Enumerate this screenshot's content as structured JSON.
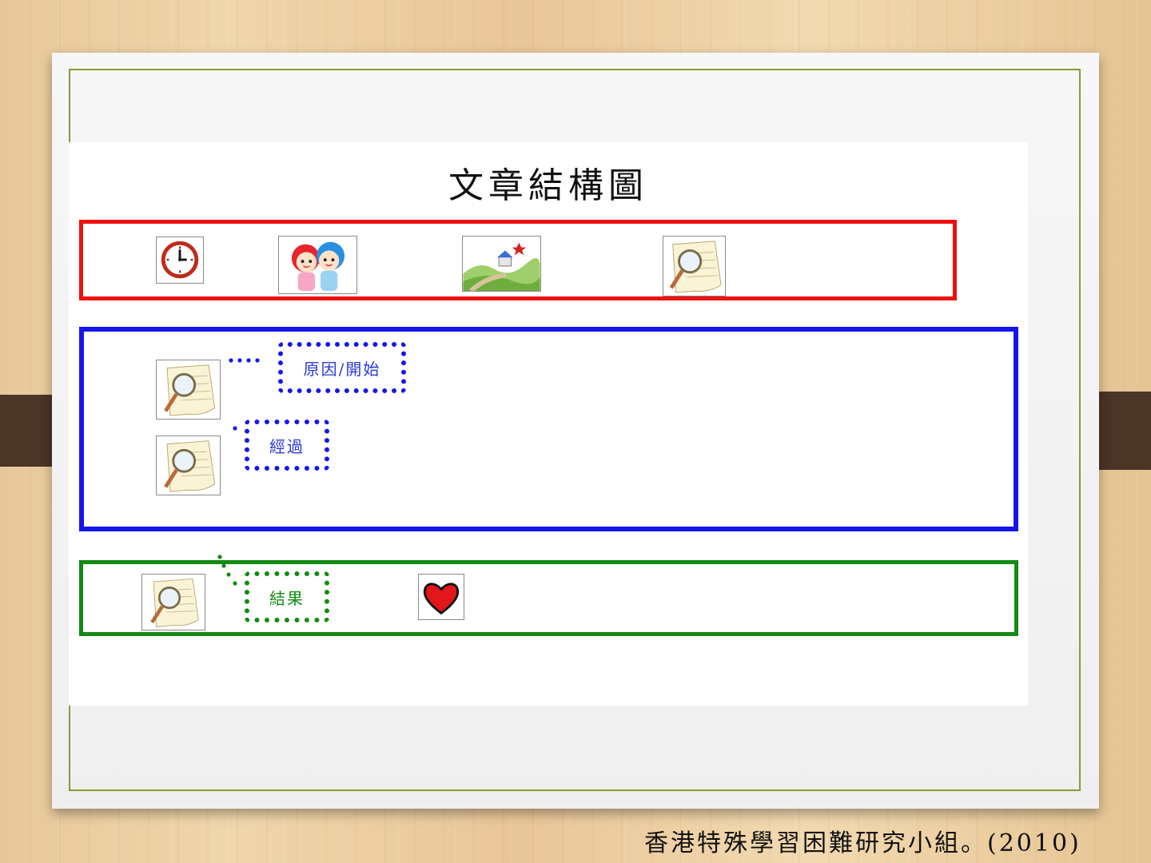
{
  "slide": {
    "title": "文章結構圖",
    "labels": {
      "cause_start": "原因/開始",
      "process": "經過",
      "result": "結果"
    }
  },
  "icons": {
    "row1": [
      "clock-icon",
      "children-icon",
      "landscape-icon",
      "magnifier-paper-icon"
    ],
    "row2": [
      "magnifier-paper-icon",
      "magnifier-paper-icon"
    ],
    "row3": [
      "magnifier-paper-icon",
      "heart-icon"
    ]
  },
  "colors": {
    "row1_border": "#ee1111",
    "row2_border": "#1515ee",
    "row3_border": "#138a13",
    "frame": "#8a9a3a"
  },
  "citation": "香港特殊學習困難研究小組。(2010)"
}
